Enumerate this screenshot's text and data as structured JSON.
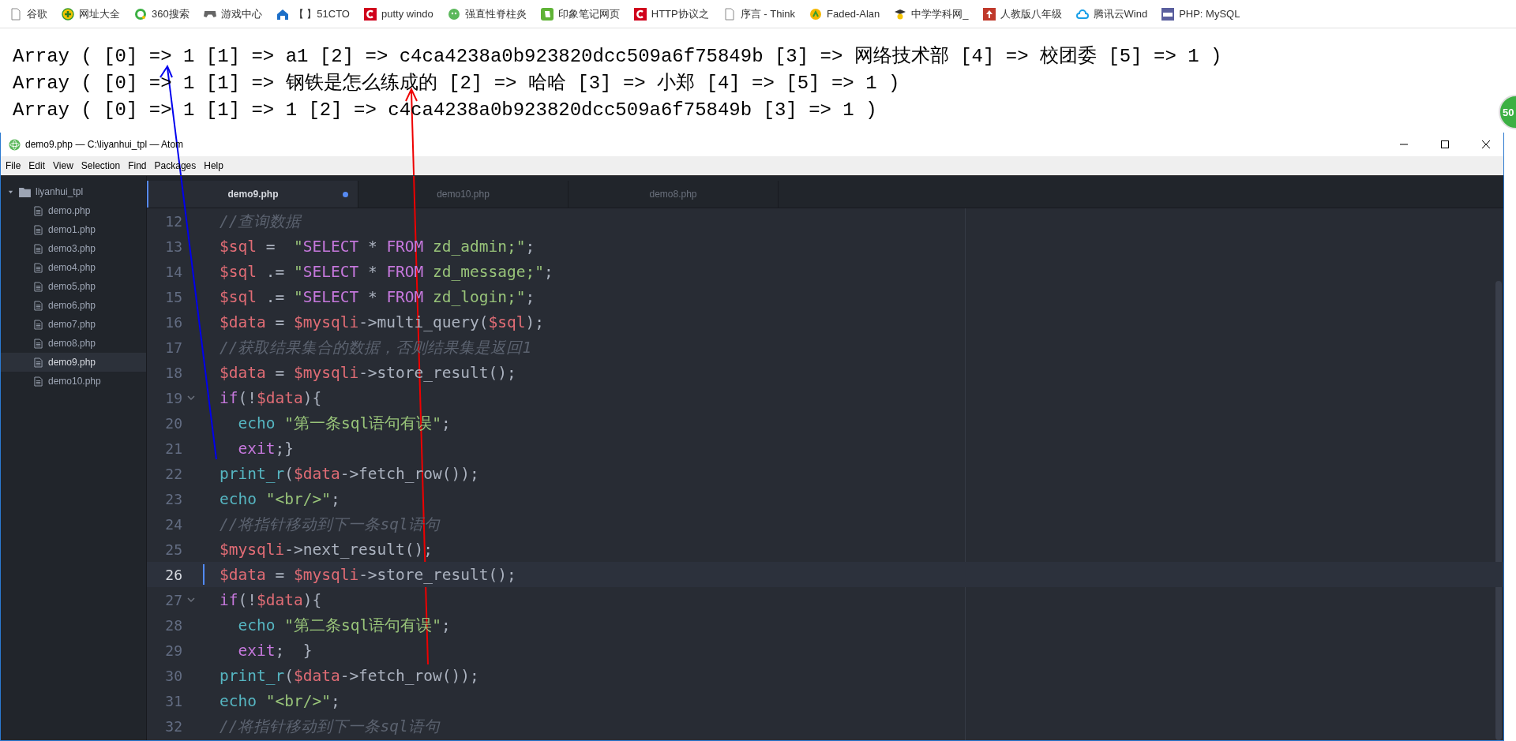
{
  "bookmarks": [
    {
      "label": "谷歌",
      "kind": "page"
    },
    {
      "label": "网址大全",
      "kind": "plus"
    },
    {
      "label": "360搜索",
      "kind": "ring"
    },
    {
      "label": "游戏中心",
      "kind": "gamepad"
    },
    {
      "label": "【 】51CTO",
      "kind": "house"
    },
    {
      "label": "putty windo",
      "kind": "letter"
    },
    {
      "label": "强直性脊柱炎",
      "kind": "face"
    },
    {
      "label": "印象笔记网页",
      "kind": "note"
    },
    {
      "label": "HTTP协议之",
      "kind": "letter"
    },
    {
      "label": "序言 - Think",
      "kind": "page"
    },
    {
      "label": "Faded-Alan",
      "kind": "coin"
    },
    {
      "label": "中学学科网_",
      "kind": "cap"
    },
    {
      "label": "人教版八年级",
      "kind": "square"
    },
    {
      "label": "腾讯云Wind",
      "kind": "cloud"
    },
    {
      "label": "PHP: MySQL",
      "kind": "php"
    }
  ],
  "output_lines": [
    "Array ( [0] => 1 [1] => a1 [2] => c4ca4238a0b923820dcc509a6f75849b [3] => 网络技术部 [4] => 校团委 [5] => 1 )",
    "Array ( [0] => 1 [1] => 钢铁是怎么练成的 [2] => 哈哈 [3] => 小郑 [4] => [5] => 1 )",
    "Array ( [0] => 1 [1] => 1 [2] => c4ca4238a0b923820dcc509a6f75849b [3] => 1 )"
  ],
  "floating_badge": "50",
  "window": {
    "title": "demo9.php — C:\\liyanhui_tpl — Atom",
    "menu": [
      "File",
      "Edit",
      "View",
      "Selection",
      "Find",
      "Packages",
      "Help"
    ],
    "tree": {
      "label": "liyanhui_tpl",
      "expanded": true,
      "children": [
        {
          "label": "demo.php",
          "selected": false
        },
        {
          "label": "demo1.php",
          "selected": false
        },
        {
          "label": "demo3.php",
          "selected": false
        },
        {
          "label": "demo4.php",
          "selected": false
        },
        {
          "label": "demo5.php",
          "selected": false
        },
        {
          "label": "demo6.php",
          "selected": false
        },
        {
          "label": "demo7.php",
          "selected": false
        },
        {
          "label": "demo8.php",
          "selected": false
        },
        {
          "label": "demo9.php",
          "selected": true
        },
        {
          "label": "demo10.php",
          "selected": false
        }
      ]
    },
    "tabs": [
      {
        "label": "demo9.php",
        "selected": true,
        "modified": true
      },
      {
        "label": "demo10.php",
        "selected": false,
        "modified": false
      },
      {
        "label": "demo8.php",
        "selected": false,
        "modified": false
      }
    ],
    "code_lines": [
      {
        "number": "12",
        "fold": false,
        "current": false,
        "tokens": [
          {
            "kind": "c",
            "text": "//查询数据"
          }
        ]
      },
      {
        "number": "13",
        "fold": false,
        "current": false,
        "tokens": [
          {
            "kind": "v",
            "text": "$sql"
          },
          {
            "kind": "p",
            "text": " =  "
          },
          {
            "kind": "s",
            "text": "\""
          },
          {
            "kind": "q",
            "text": "SELECT"
          },
          {
            "kind": "p",
            "text": " * "
          },
          {
            "kind": "q",
            "text": "FROM"
          },
          {
            "kind": "s",
            "text": " zd_admin;\""
          },
          {
            "kind": "p",
            "text": ";"
          }
        ]
      },
      {
        "number": "14",
        "fold": false,
        "current": false,
        "tokens": [
          {
            "kind": "v",
            "text": "$sql"
          },
          {
            "kind": "p",
            "text": " .= "
          },
          {
            "kind": "s",
            "text": "\""
          },
          {
            "kind": "q",
            "text": "SELECT"
          },
          {
            "kind": "p",
            "text": " * "
          },
          {
            "kind": "q",
            "text": "FROM"
          },
          {
            "kind": "s",
            "text": " zd_message;\""
          },
          {
            "kind": "p",
            "text": ";"
          }
        ]
      },
      {
        "number": "15",
        "fold": false,
        "current": false,
        "tokens": [
          {
            "kind": "v",
            "text": "$sql"
          },
          {
            "kind": "p",
            "text": " .= "
          },
          {
            "kind": "s",
            "text": "\""
          },
          {
            "kind": "q",
            "text": "SELECT"
          },
          {
            "kind": "p",
            "text": " * "
          },
          {
            "kind": "q",
            "text": "FROM"
          },
          {
            "kind": "s",
            "text": " zd_login;\""
          },
          {
            "kind": "p",
            "text": ";"
          }
        ]
      },
      {
        "number": "16",
        "fold": false,
        "current": false,
        "tokens": [
          {
            "kind": "v",
            "text": "$data"
          },
          {
            "kind": "p",
            "text": " = "
          },
          {
            "kind": "v",
            "text": "$mysqli"
          },
          {
            "kind": "p",
            "text": "->multi_query("
          },
          {
            "kind": "v",
            "text": "$sql"
          },
          {
            "kind": "p",
            "text": ");"
          }
        ]
      },
      {
        "number": "17",
        "fold": false,
        "current": false,
        "tokens": [
          {
            "kind": "c",
            "text": "//获取结果集合的数据，否则结果集是返回1"
          }
        ]
      },
      {
        "number": "18",
        "fold": false,
        "current": false,
        "tokens": [
          {
            "kind": "v",
            "text": "$data"
          },
          {
            "kind": "p",
            "text": " = "
          },
          {
            "kind": "v",
            "text": "$mysqli"
          },
          {
            "kind": "p",
            "text": "->store_result();"
          }
        ]
      },
      {
        "number": "19",
        "fold": true,
        "current": false,
        "tokens": [
          {
            "kind": "k",
            "text": "if"
          },
          {
            "kind": "p",
            "text": "(!"
          },
          {
            "kind": "v",
            "text": "$data"
          },
          {
            "kind": "p",
            "text": "){"
          }
        ]
      },
      {
        "number": "20",
        "fold": false,
        "current": false,
        "tokens": [
          {
            "kind": "f",
            "text": "  echo"
          },
          {
            "kind": "s",
            "text": " \"第一条sql语句有误\""
          },
          {
            "kind": "p",
            "text": ";"
          }
        ]
      },
      {
        "number": "21",
        "fold": false,
        "current": false,
        "tokens": [
          {
            "kind": "k",
            "text": "  exit"
          },
          {
            "kind": "p",
            "text": ";}"
          }
        ]
      },
      {
        "number": "22",
        "fold": false,
        "current": false,
        "tokens": [
          {
            "kind": "f",
            "text": "print_r"
          },
          {
            "kind": "p",
            "text": "("
          },
          {
            "kind": "v",
            "text": "$data"
          },
          {
            "kind": "p",
            "text": "->fetch_row());"
          }
        ]
      },
      {
        "number": "23",
        "fold": false,
        "current": false,
        "tokens": [
          {
            "kind": "f",
            "text": "echo"
          },
          {
            "kind": "s",
            "text": " \"<br/>\""
          },
          {
            "kind": "p",
            "text": ";"
          }
        ]
      },
      {
        "number": "24",
        "fold": false,
        "current": false,
        "tokens": [
          {
            "kind": "c",
            "text": "//将指针移动到下一条sql语句"
          }
        ]
      },
      {
        "number": "25",
        "fold": false,
        "current": false,
        "tokens": [
          {
            "kind": "v",
            "text": "$mysqli"
          },
          {
            "kind": "p",
            "text": "->next_result();"
          }
        ]
      },
      {
        "number": "26",
        "fold": false,
        "current": true,
        "tokens": [
          {
            "kind": "v",
            "text": "$data"
          },
          {
            "kind": "p",
            "text": " = "
          },
          {
            "kind": "v",
            "text": "$mysqli"
          },
          {
            "kind": "p",
            "text": "->store_result();"
          }
        ]
      },
      {
        "number": "27",
        "fold": true,
        "current": false,
        "tokens": [
          {
            "kind": "k",
            "text": "if"
          },
          {
            "kind": "p",
            "text": "(!"
          },
          {
            "kind": "v",
            "text": "$data"
          },
          {
            "kind": "p",
            "text": "){"
          }
        ]
      },
      {
        "number": "28",
        "fold": false,
        "current": false,
        "tokens": [
          {
            "kind": "f",
            "text": "  echo"
          },
          {
            "kind": "s",
            "text": " \"第二条sql语句有误\""
          },
          {
            "kind": "p",
            "text": ";"
          }
        ]
      },
      {
        "number": "29",
        "fold": false,
        "current": false,
        "tokens": [
          {
            "kind": "k",
            "text": "  exit"
          },
          {
            "kind": "p",
            "text": ";  }"
          }
        ]
      },
      {
        "number": "30",
        "fold": false,
        "current": false,
        "tokens": [
          {
            "kind": "f",
            "text": "print_r"
          },
          {
            "kind": "p",
            "text": "("
          },
          {
            "kind": "v",
            "text": "$data"
          },
          {
            "kind": "p",
            "text": "->fetch_row());"
          }
        ]
      },
      {
        "number": "31",
        "fold": false,
        "current": false,
        "tokens": [
          {
            "kind": "f",
            "text": "echo"
          },
          {
            "kind": "s",
            "text": " \"<br/>\""
          },
          {
            "kind": "p",
            "text": ";"
          }
        ]
      },
      {
        "number": "32",
        "fold": false,
        "current": false,
        "tokens": [
          {
            "kind": "c",
            "text": "//将指针移动到下一条sql语句"
          }
        ]
      }
    ]
  }
}
